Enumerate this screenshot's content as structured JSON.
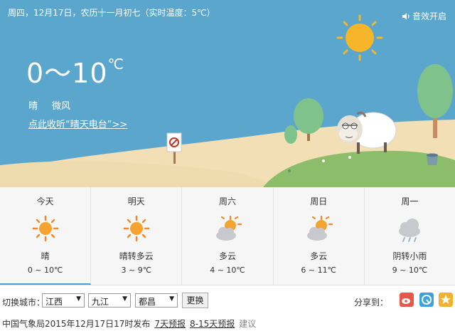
{
  "header": {
    "date_line": "周四，12月17日，农历十一月初七（实时温度：5℃）",
    "sound_label": "音效开启"
  },
  "current": {
    "temp_range": "0～10",
    "unit": "℃",
    "weather": "晴",
    "wind": "微风",
    "radio_link": "点此收听“晴天电台”>>"
  },
  "forecast": [
    {
      "day": "今天",
      "condition": "晴",
      "temp": "0 ~ 10℃",
      "icon": "sun-icon",
      "active": true
    },
    {
      "day": "明天",
      "condition": "晴转多云",
      "temp": "3 ~ 9℃",
      "icon": "sun-icon",
      "active": false
    },
    {
      "day": "周六",
      "condition": "多云",
      "temp": "4 ~ 10℃",
      "icon": "partly-cloudy-icon",
      "active": false
    },
    {
      "day": "周日",
      "condition": "多云",
      "temp": "6 ~ 11℃",
      "icon": "partly-cloudy-icon",
      "active": false
    },
    {
      "day": "周一",
      "condition": "阴转小雨",
      "temp": "9 ~ 10℃",
      "icon": "rain-cloud-icon",
      "active": false
    }
  ],
  "controls": {
    "switch_city_label": "切换城市：",
    "province": "江西",
    "city": "九江",
    "district": "都昌",
    "switch_button": "更换",
    "share_label": "分享到："
  },
  "footer": {
    "publish": "中国气象局2015年12月17日17时发布",
    "link_7day": "7天预报",
    "link_8_15day": "8-15天预报",
    "suggest": "建议"
  },
  "colors": {
    "sky": "#5aa6cc",
    "sun": "#f7b52a",
    "hill": "#f2dfb6",
    "grass": "#8cbd6a",
    "active_tab": "#4a9fd1"
  }
}
